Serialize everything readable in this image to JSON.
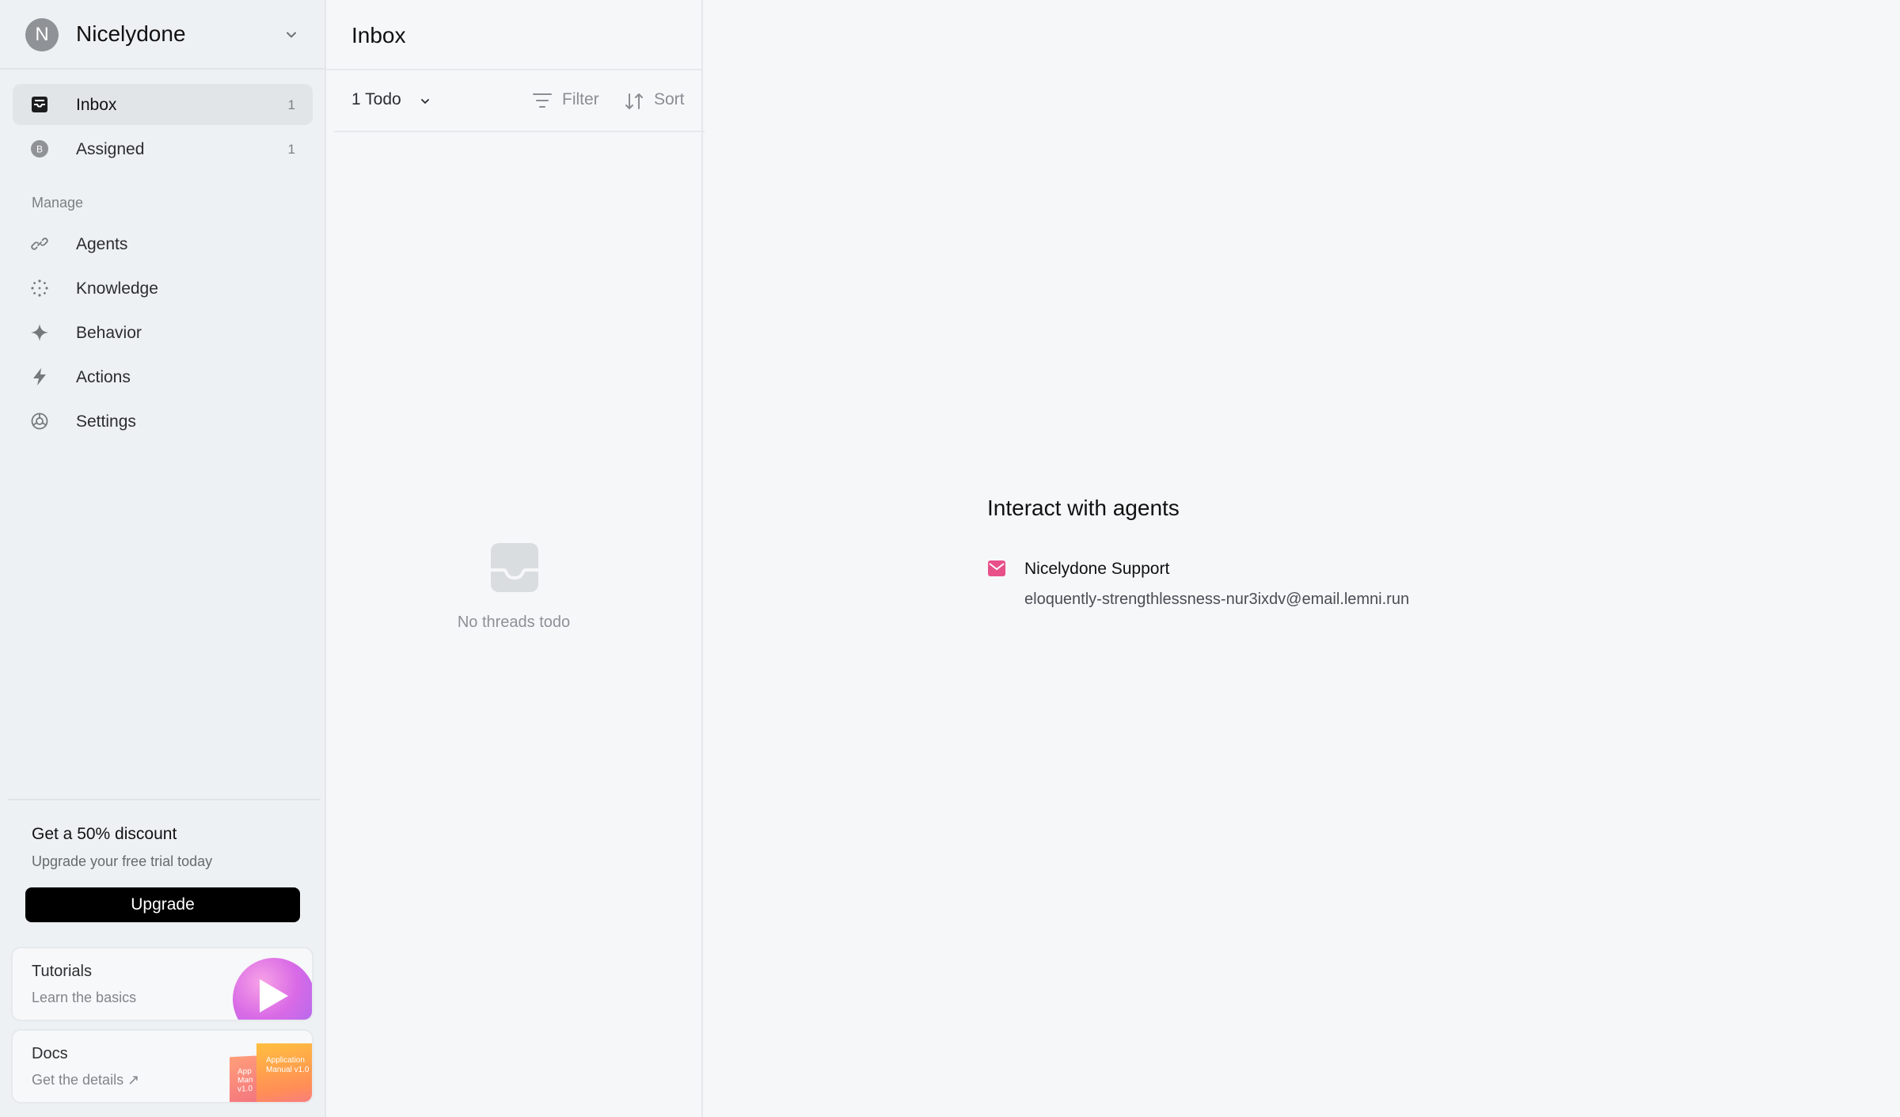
{
  "workspace": {
    "avatar_letter": "N",
    "name": "Nicelydone"
  },
  "nav": {
    "inbox": {
      "label": "Inbox",
      "count": "1"
    },
    "assigned": {
      "label": "Assigned",
      "count": "1",
      "avatar_letter": "B"
    }
  },
  "manage": {
    "section_label": "Manage",
    "items": [
      {
        "label": "Agents",
        "icon": "link-icon"
      },
      {
        "label": "Knowledge",
        "icon": "sparkle-dots-icon"
      },
      {
        "label": "Behavior",
        "icon": "sparkle-icon"
      },
      {
        "label": "Actions",
        "icon": "bolt-icon"
      },
      {
        "label": "Settings",
        "icon": "settings-icon"
      }
    ]
  },
  "promo": {
    "title": "Get a 50% discount",
    "subtitle": "Upgrade your free trial today",
    "button": "Upgrade"
  },
  "cards": {
    "tutorials": {
      "title": "Tutorials",
      "subtitle": "Learn the basics"
    },
    "docs": {
      "title": "Docs",
      "subtitle": "Get the details ↗",
      "art_text_back": "App Man v1.0",
      "art_text_front": "Application Manual v1.0"
    }
  },
  "thread_list": {
    "title": "Inbox",
    "todo_filter": "1 Todo",
    "filter_label": "Filter",
    "sort_label": "Sort",
    "empty_text": "No threads todo"
  },
  "main": {
    "title": "Interact with agents",
    "agent": {
      "name": "Nicelydone Support",
      "email": "eloquently-strengthlessness-nur3ixdv@email.lemni.run"
    }
  },
  "colors": {
    "accent_pink": "#e8508a",
    "button_bg": "#000000",
    "sidebar_bg": "#eef1f3",
    "page_bg": "#f6f7f9"
  }
}
